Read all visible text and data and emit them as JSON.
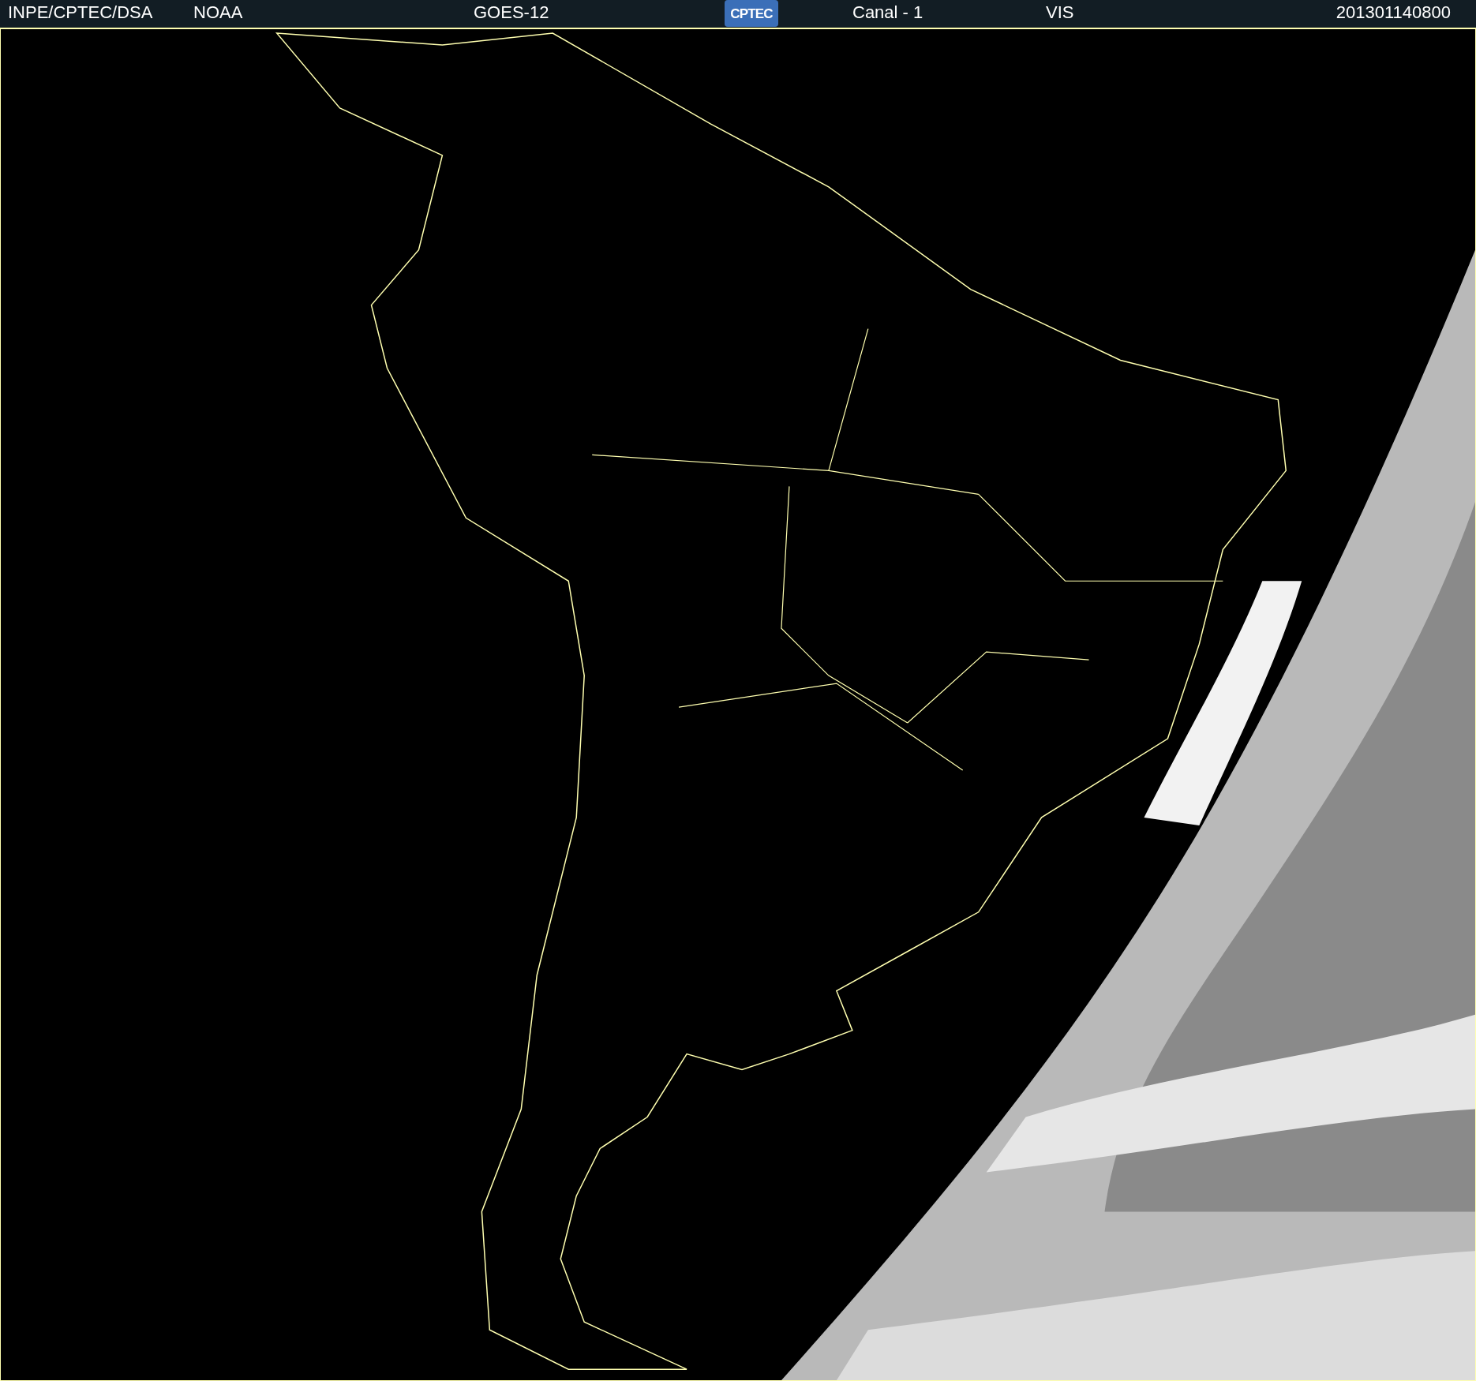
{
  "header": {
    "source": "INPE/CPTEC/DSA",
    "agency": "NOAA",
    "satellite": "GOES-12",
    "logo_text": "CPTEC",
    "channel": "Canal - 1",
    "band": "VIS",
    "timestamp": "201301140800"
  }
}
